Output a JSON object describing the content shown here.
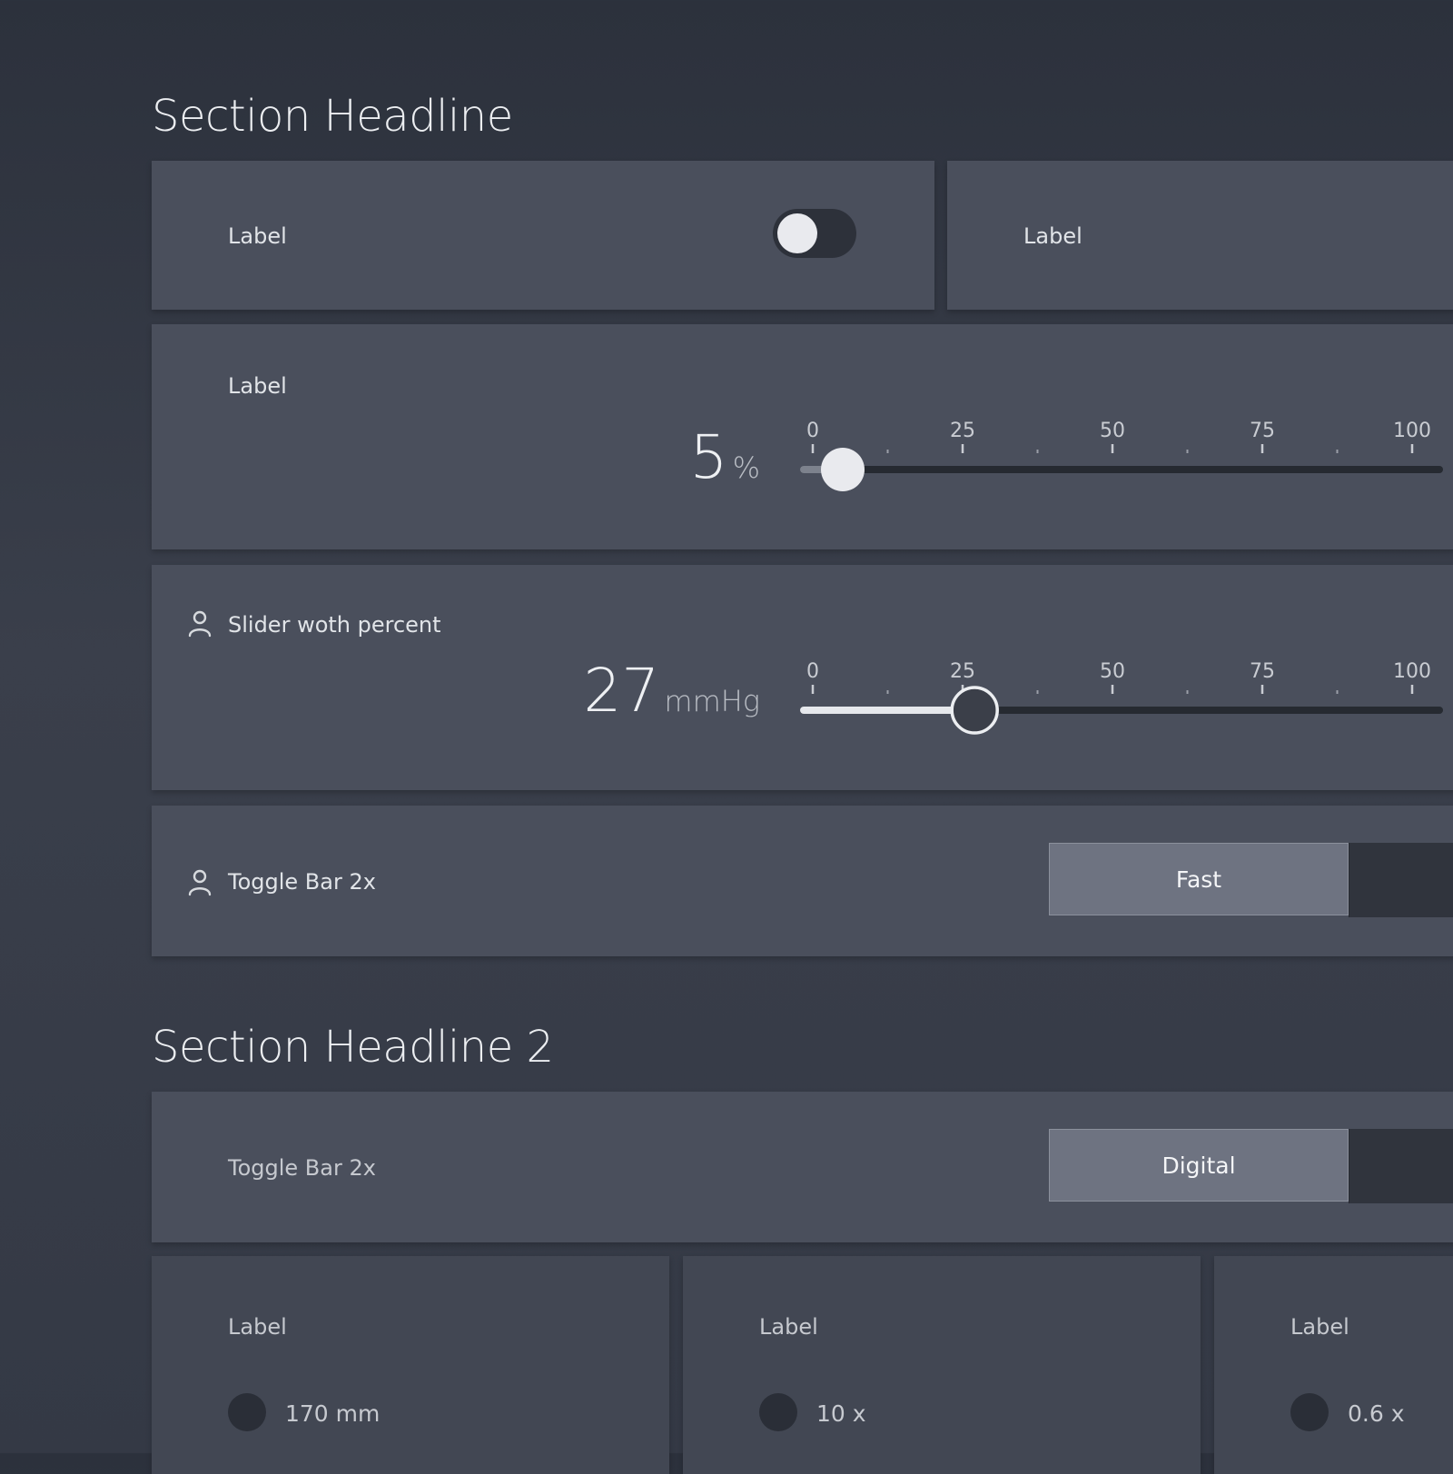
{
  "section1": {
    "headline": "Section Headline",
    "toggle_row": {
      "label_left": "Label",
      "switch_state": "off",
      "label_right": "Label"
    },
    "slider1": {
      "label": "Label",
      "value": "5",
      "unit": "%",
      "level": 5,
      "ticks": [
        "0",
        "25",
        "50",
        "75",
        "100"
      ]
    },
    "slider2": {
      "label": "Slider woth percent",
      "value": "27",
      "unit": "mmHg",
      "level": 27,
      "ticks": [
        "0",
        "25",
        "50",
        "75",
        "100"
      ]
    },
    "togglebar": {
      "label": "Toggle Bar 2x",
      "active": "Fast"
    }
  },
  "section2": {
    "headline": "Section Headline 2",
    "togglebar": {
      "label": "Toggle Bar 2x",
      "active": "Digital"
    },
    "items": [
      {
        "label": "Label",
        "value": "170 mm"
      },
      {
        "label": "Label",
        "value": "10 x"
      },
      {
        "label": "Label",
        "value": "0.6 x"
      }
    ]
  },
  "colors": {
    "background": "#343945",
    "card": "#4a4f5c",
    "track": "#262a31",
    "thumb": "#e9eaee",
    "segment_active": "#6e7381"
  },
  "icons": [
    "person-icon"
  ]
}
